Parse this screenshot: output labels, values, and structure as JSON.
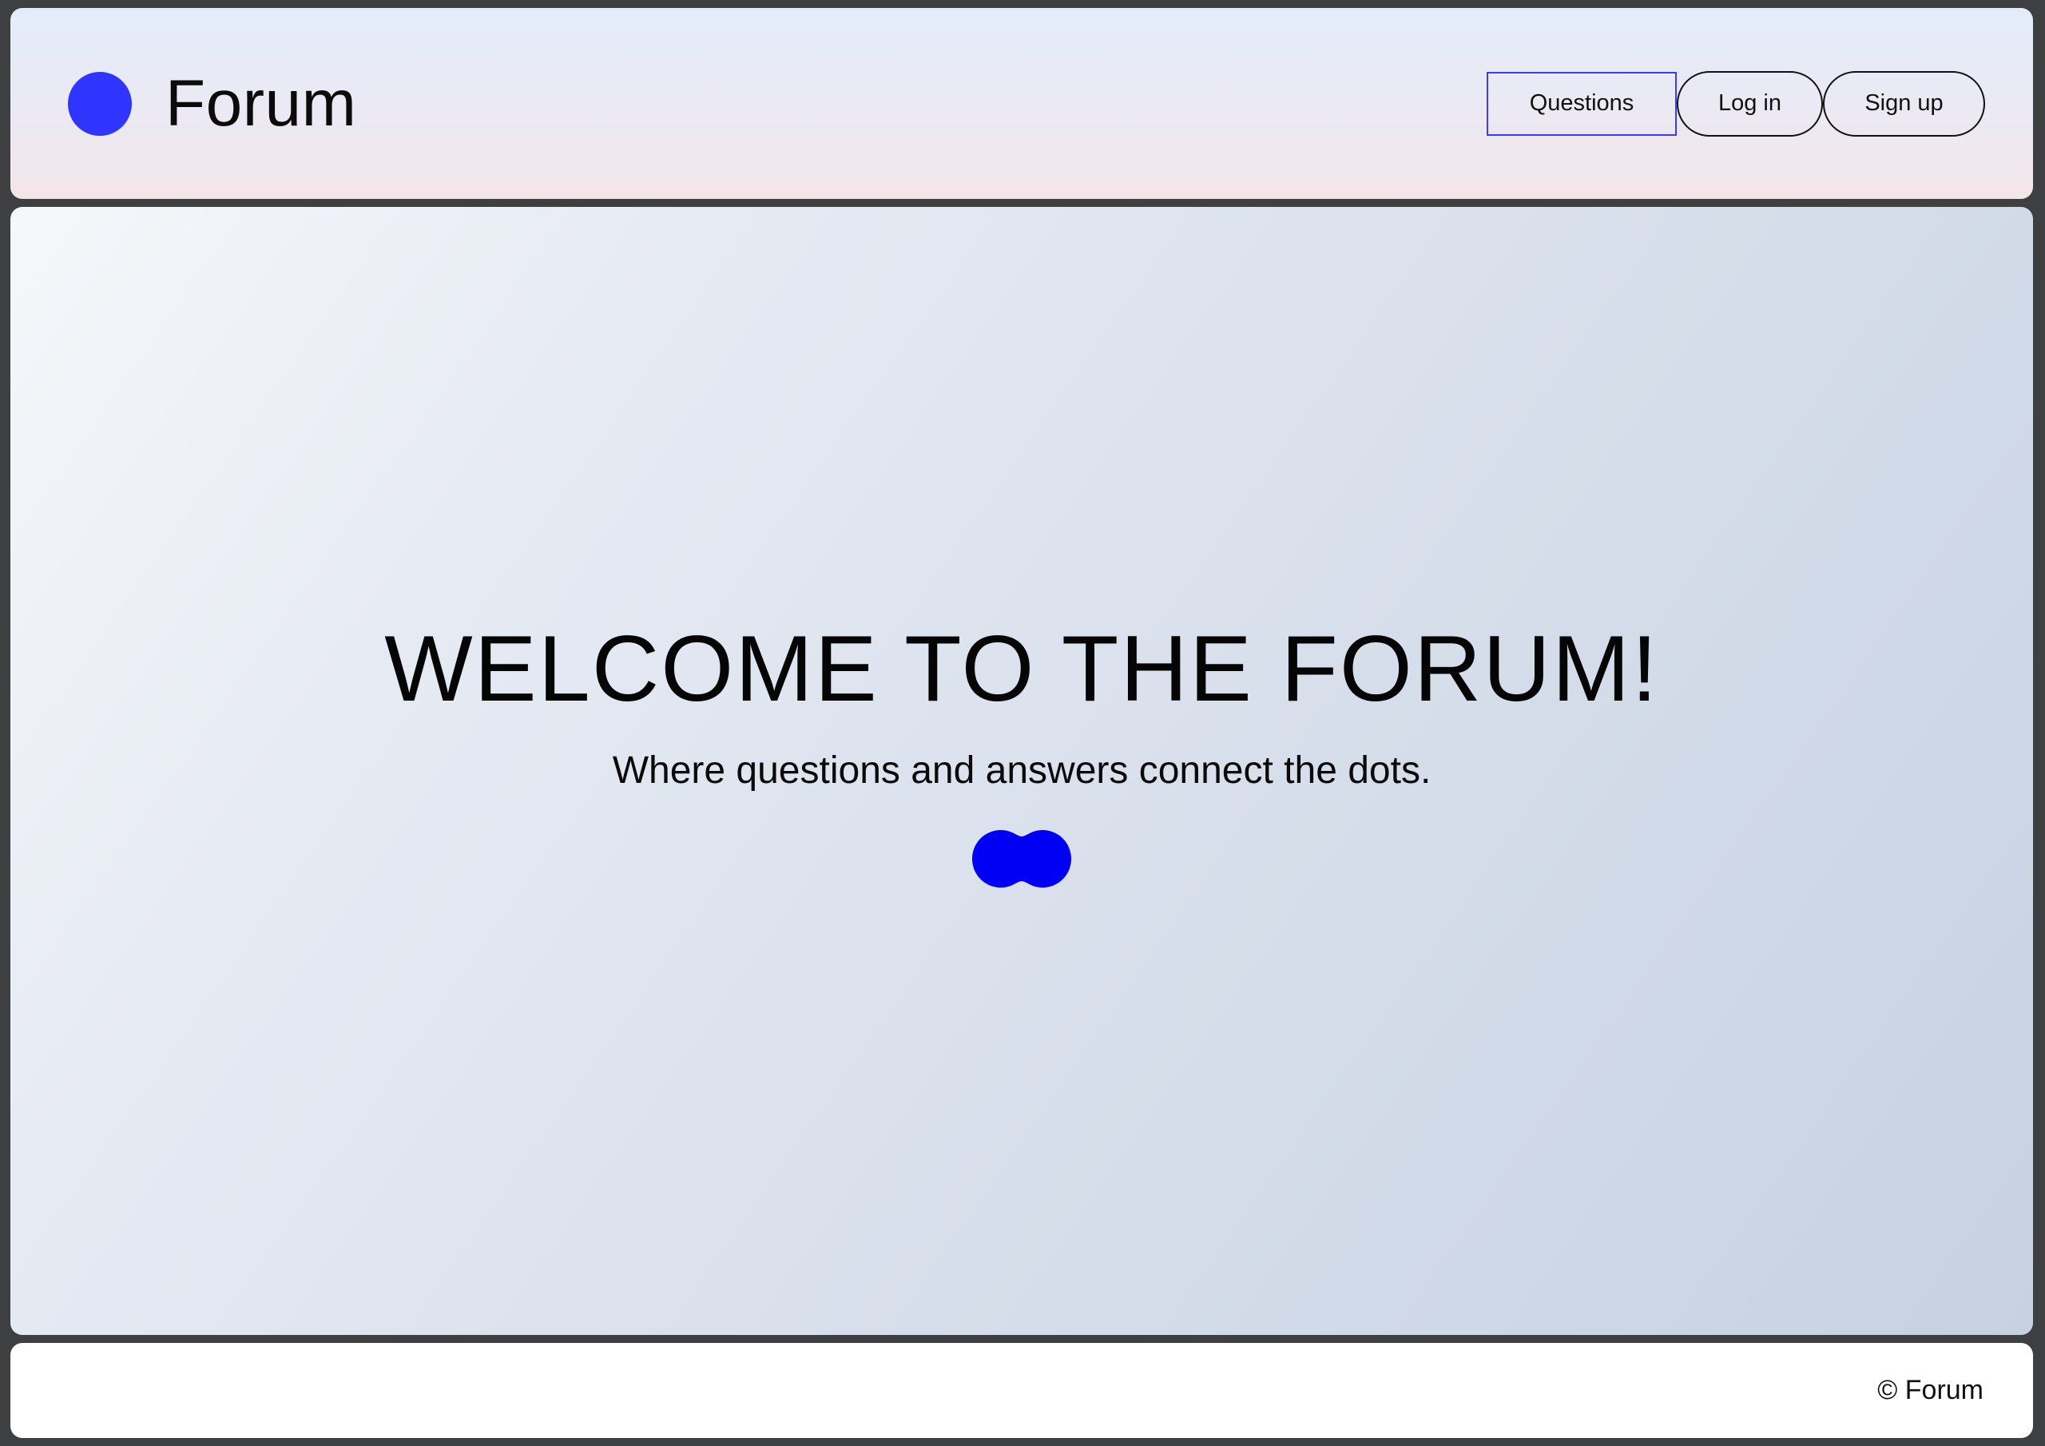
{
  "header": {
    "brand_name": "Forum",
    "nav": {
      "questions_label": "Questions",
      "login_label": "Log in",
      "signup_label": "Sign up"
    }
  },
  "hero": {
    "title": "WELCOME TO THE FORUM!",
    "subtitle": "Where questions and answers connect the dots."
  },
  "footer": {
    "copyright": "© Forum"
  },
  "colors": {
    "accent": "#2f35ff",
    "blob": "#0000f5",
    "active_border": "#3a3df0"
  },
  "icons": {
    "logo": "blue-dot-logo-icon",
    "hero_mark": "connected-dots-icon"
  }
}
